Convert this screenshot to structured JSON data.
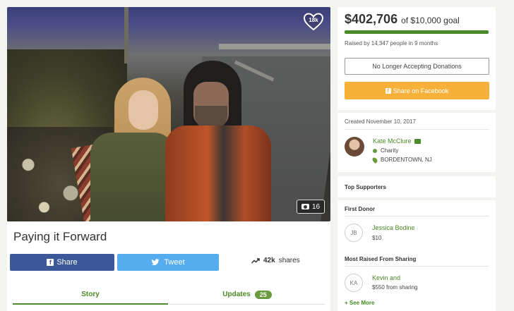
{
  "photo": {
    "heart_count": "18k",
    "photo_count": "16"
  },
  "campaign": {
    "title": "Paying it Forward"
  },
  "share": {
    "facebook_label": "Share",
    "tweet_label": "Tweet",
    "shares_count": "42k",
    "shares_label": "shares"
  },
  "tabs": {
    "story": "Story",
    "updates": "Updates",
    "updates_count": "25"
  },
  "donation": {
    "amount": "$402,706",
    "goal": "of $10,000 goal",
    "progress_fraction": 1.0,
    "raised_text": "Raised by 14,347 people in 9 months",
    "closed_label": "No Longer Accepting Donations",
    "share_facebook_label": "Share on Facebook"
  },
  "organizer": {
    "created": "Created November 10, 2017",
    "name": "Kate McClure",
    "role": "Charity",
    "location": "BORDENTOWN, NJ"
  },
  "supporters": {
    "heading": "Top Supporters",
    "first_donor_heading": "First Donor",
    "first_donor": {
      "initials": "JB",
      "name": "Jessica Bodine",
      "amount": "$10"
    },
    "most_raised_heading": "Most Raised From Sharing",
    "most_raised": {
      "initials": "KA",
      "name": "Kevin and",
      "amount": "$550 from sharing"
    },
    "see_more": "+ See More"
  },
  "colors": {
    "brand_green": "#4a8a28",
    "facebook_blue": "#3b5998",
    "twitter_blue": "#55acee",
    "share_orange": "#f6b13b"
  }
}
